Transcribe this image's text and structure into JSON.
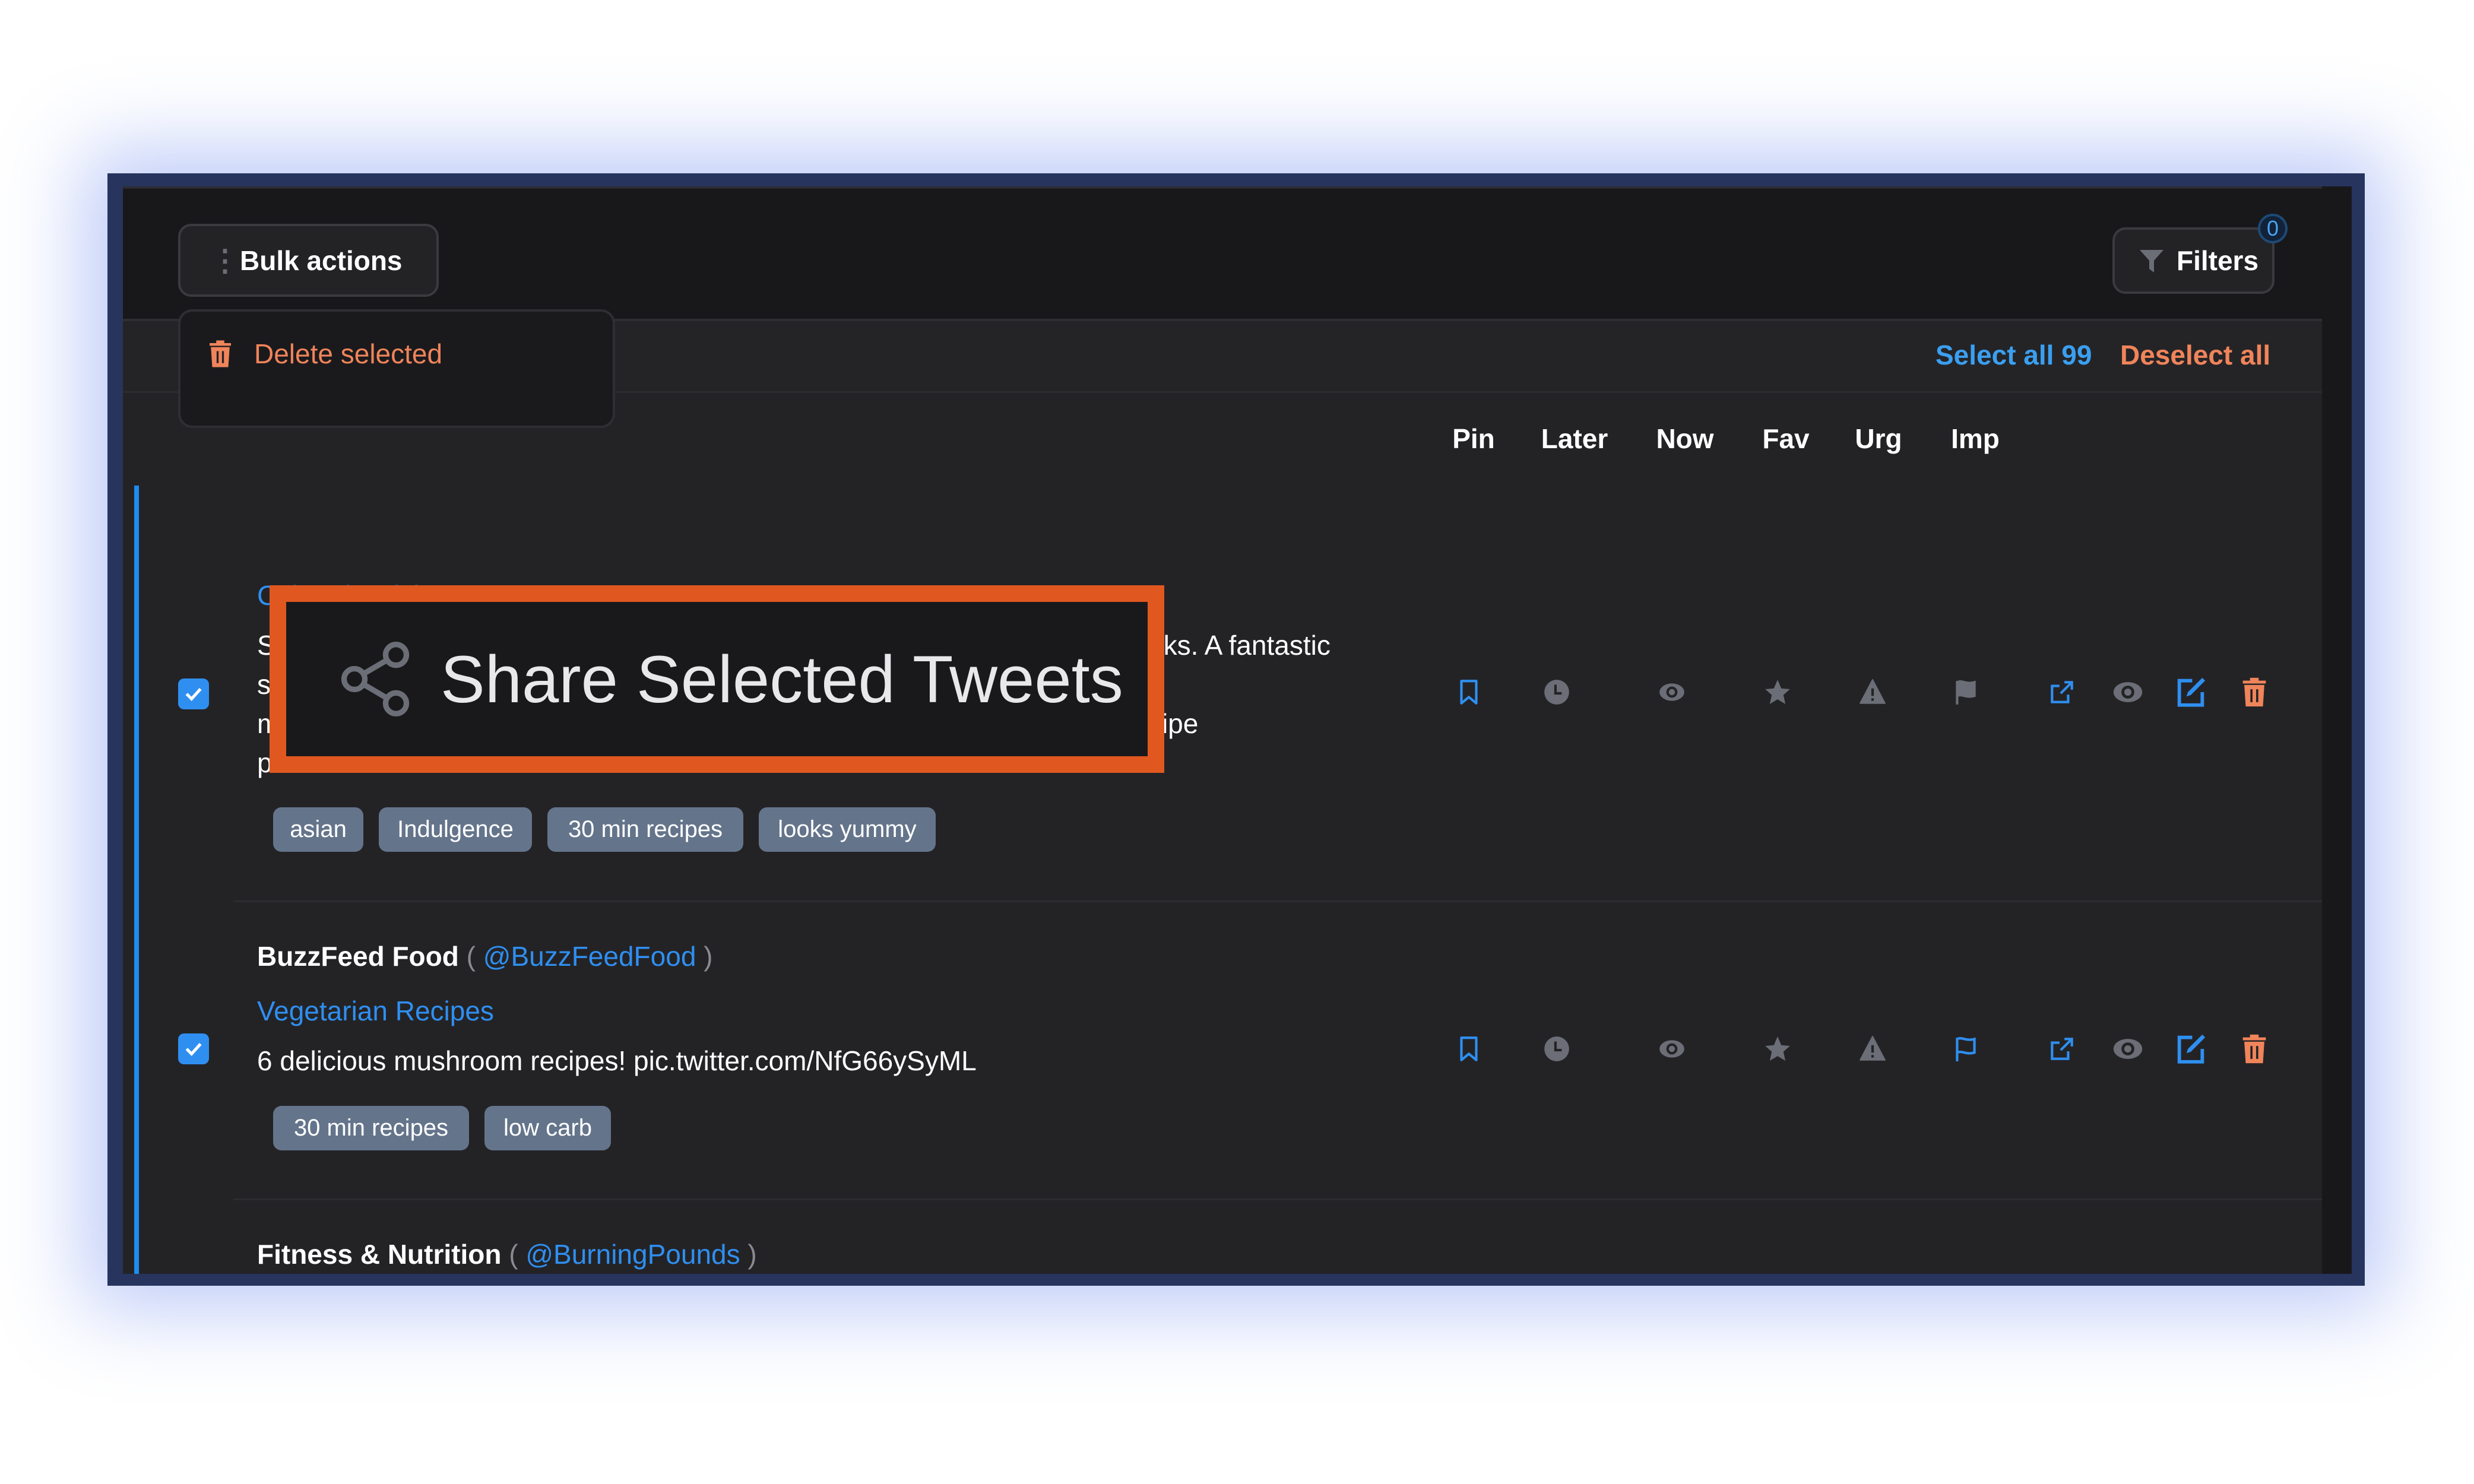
{
  "toolbar": {
    "bulk_actions_label": "Bulk actions",
    "filters_label": "Filters",
    "filters_count": "0"
  },
  "selection": {
    "select_all_label": "Select all 99",
    "deselect_all_label": "Deselect all"
  },
  "bulk_menu": {
    "items": [
      {
        "label": "Delete selected",
        "icon": "trash-icon"
      }
    ]
  },
  "share_callout": {
    "label": "Share Selected Tweets",
    "icon": "share-icon"
  },
  "columns": [
    "Pin",
    "Later",
    "Now",
    "Fav",
    "Urg",
    "Imp"
  ],
  "colors": {
    "accent_blue": "#2f8ff0",
    "danger_orange": "#f0845a",
    "icon_gray": "#6b6e76",
    "highlight_border": "#e0581f",
    "tag_bg": "#64748b"
  },
  "tweets": [
    {
      "checked": true,
      "category": "Cultural Cuisine",
      "text_lines": [
        "Sweet and savoury Pad Thai with ALL the toppings is way easier than it looks. A fantastic",
        "street food dish you can make at home in 30",
        "minutes.https://t.co/Y9cOyhDoM7#kitchensanctuary #foodie #seafood #recipe",
        "pic.twitter.com/TKOYCuwPsN"
      ],
      "tags": [
        "asian",
        "Indulgence",
        "30 min recipes",
        "looks yummy"
      ],
      "flags": {
        "pin": true,
        "later": false,
        "now": false,
        "fav": false,
        "urg": false,
        "imp": false
      }
    },
    {
      "checked": true,
      "author_name": "BuzzFeed Food",
      "author_handle": "@BuzzFeedFood",
      "category": "Vegetarian Recipes",
      "text_lines": [
        "6 delicious mushroom recipes! pic.twitter.com/NfG66ySyML"
      ],
      "tags": [
        "30 min recipes",
        "low carb"
      ],
      "flags": {
        "pin": true,
        "later": false,
        "now": false,
        "fav": false,
        "urg": false,
        "imp": true
      }
    },
    {
      "author_name": "Fitness & Nutrition",
      "author_handle": "@BurningPounds"
    }
  ],
  "punct": {
    "open": " ( ",
    "close": " )"
  }
}
